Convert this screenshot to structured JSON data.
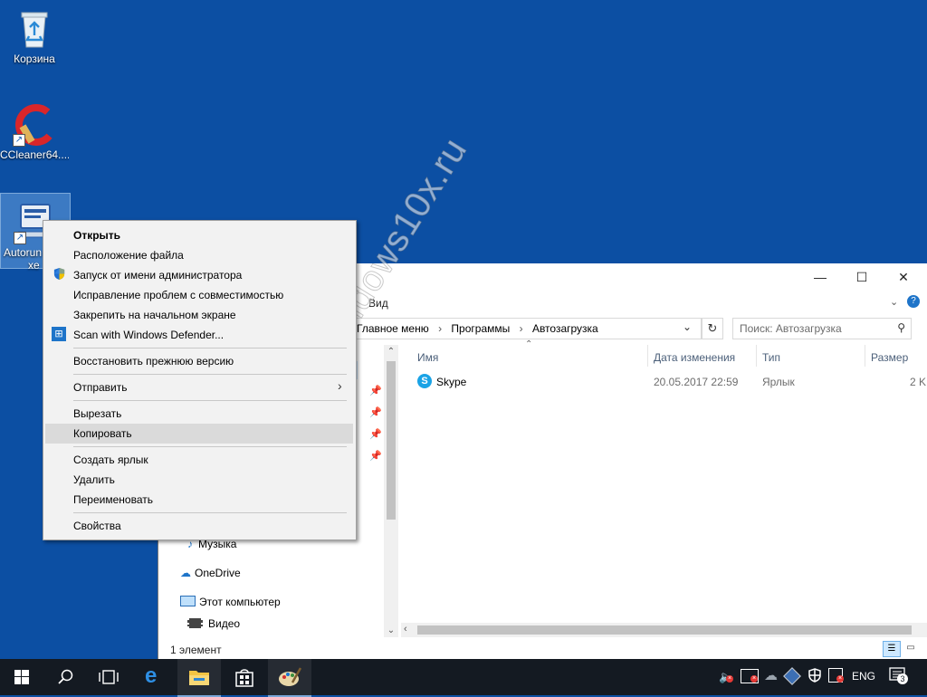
{
  "desktop": {
    "icons": [
      {
        "label": "Корзина"
      },
      {
        "label": "CCleaner64...."
      },
      {
        "label": "Autoruns64.exe",
        "label_visible_1": "Autorun",
        "label_visible_2": "xe"
      }
    ]
  },
  "explorer": {
    "ribbon_tab_view": "Вид",
    "address": {
      "crumb1": "Главное меню",
      "crumb2": "Программы",
      "crumb3": "Автозагрузка"
    },
    "search_placeholder": "Поиск: Автозагрузка",
    "columns": {
      "name": "Имя",
      "date": "Дата изменения",
      "type": "Тип",
      "size": "Размер"
    },
    "files": [
      {
        "name": "Skype",
        "date": "20.05.2017 22:59",
        "type": "Ярлык",
        "size": "2 K"
      }
    ],
    "nav": {
      "music": "Музыка",
      "onedrive": "OneDrive",
      "this_pc": "Этот компьютер",
      "video": "Видео"
    },
    "status": "1 элемент"
  },
  "context_menu": {
    "items": [
      {
        "label": "Открыть"
      },
      {
        "label": "Расположение файла"
      },
      {
        "label": "Запуск от имени администратора"
      },
      {
        "label": "Исправление проблем с совместимостью"
      },
      {
        "label": "Закрепить на начальном экране"
      },
      {
        "label": "Scan with Windows Defender..."
      },
      {
        "label": "Восстановить прежнюю версию"
      },
      {
        "label": "Отправить"
      },
      {
        "label": "Вырезать"
      },
      {
        "label": "Копировать"
      },
      {
        "label": "Создать ярлык"
      },
      {
        "label": "Удалить"
      },
      {
        "label": "Переименовать"
      },
      {
        "label": "Свойства"
      }
    ],
    "highlighted_index": 9
  },
  "taskbar": {
    "language": "ENG",
    "notifications_count": "3"
  },
  "watermark": "windows10x.ru",
  "colors": {
    "desktop": "#0c4fa3",
    "taskbar": "#141a22",
    "menu_bg": "#f2f2f2",
    "menu_highlight": "#dadada",
    "accent": "#0078d7"
  }
}
